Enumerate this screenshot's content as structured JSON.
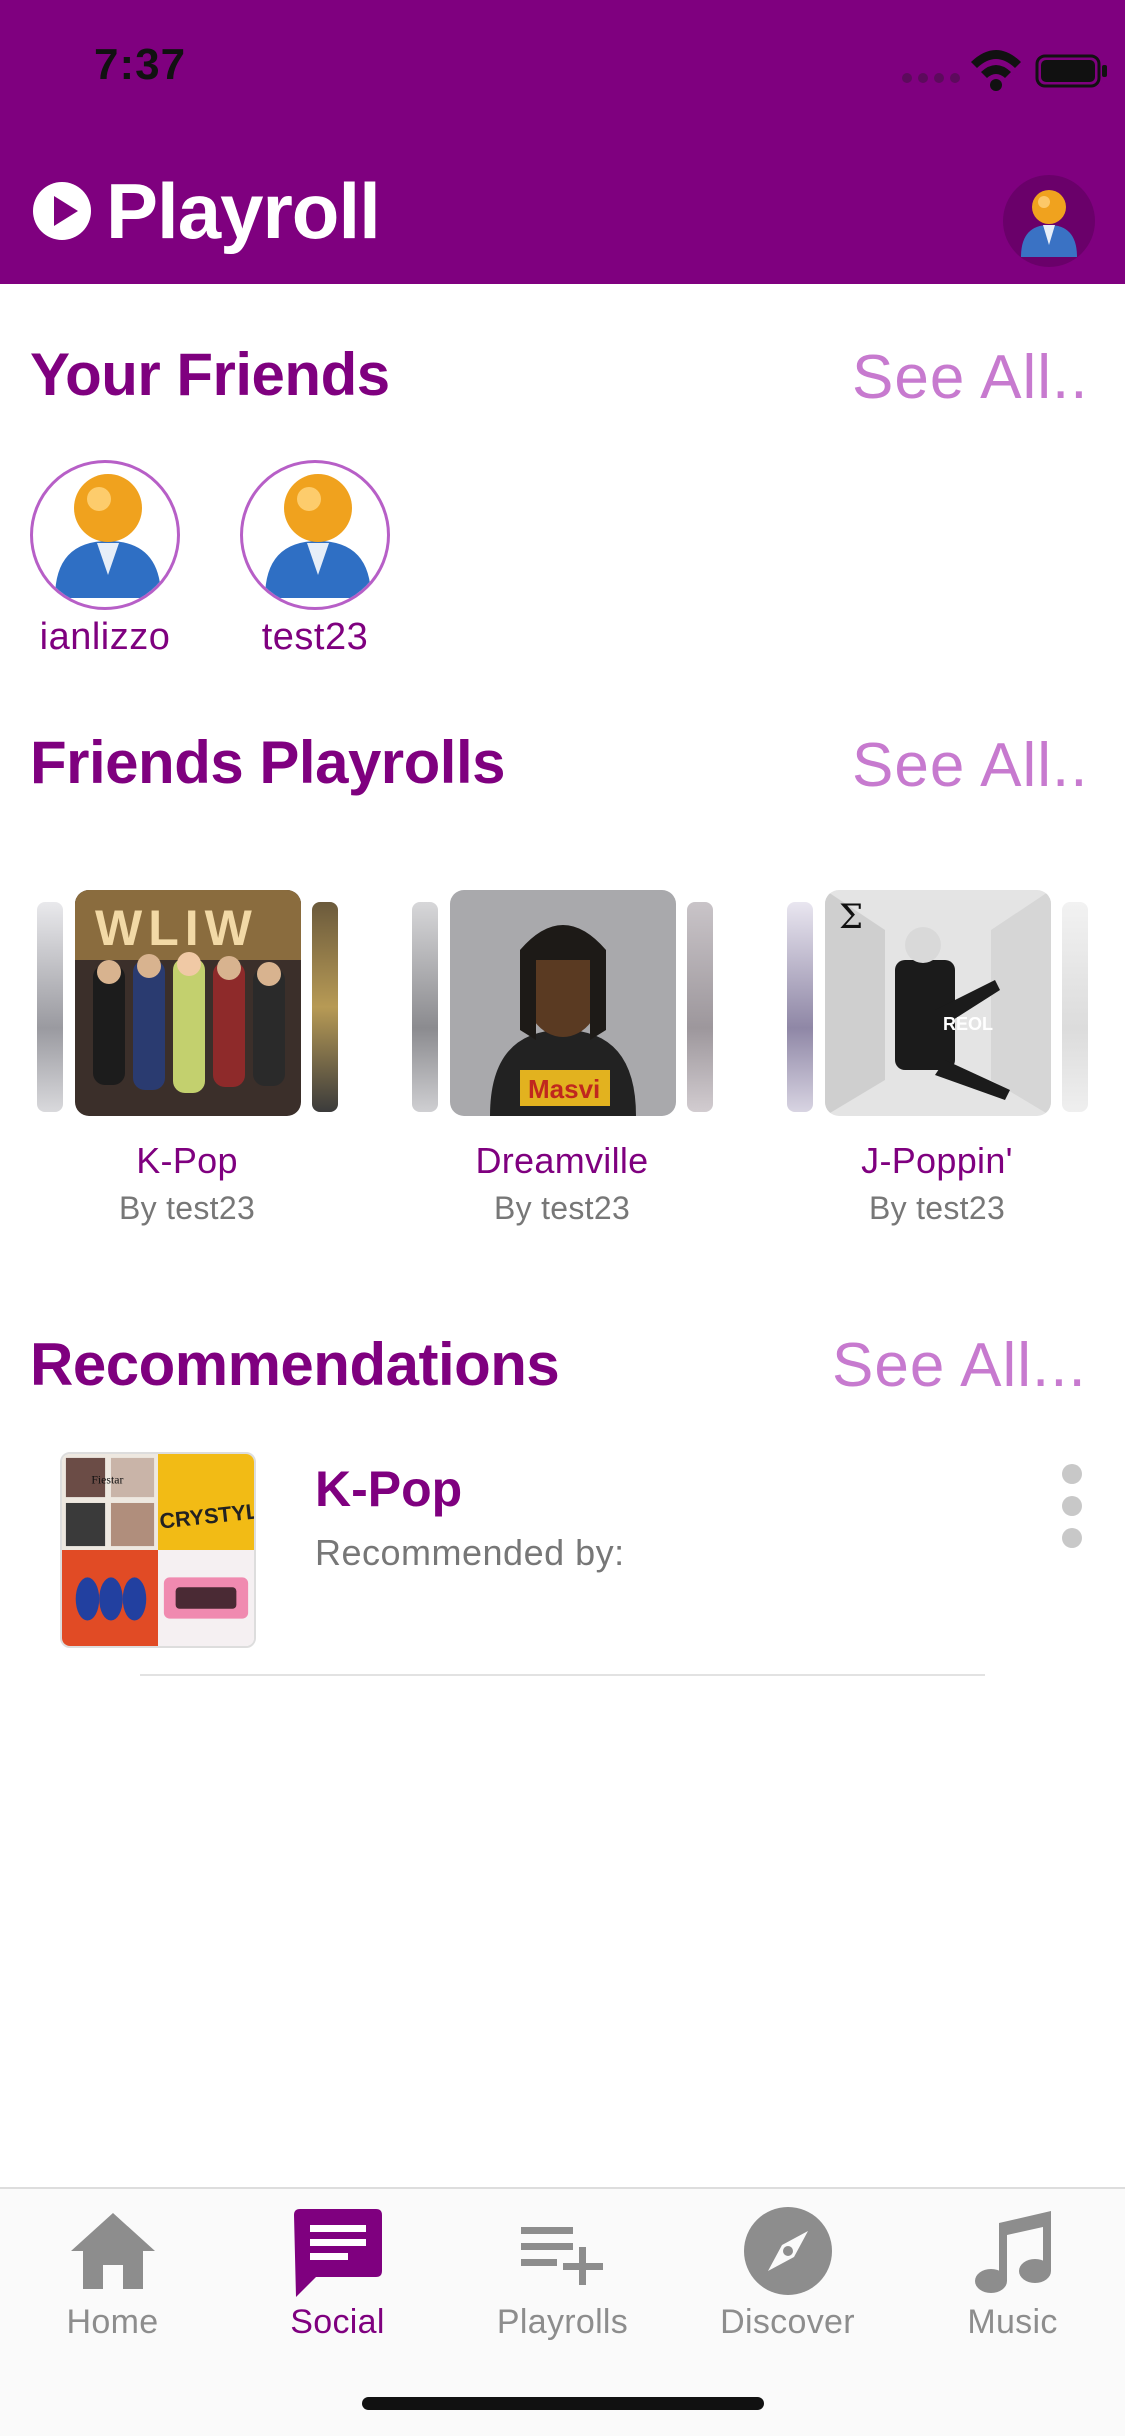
{
  "status_bar": {
    "time": "7:37"
  },
  "header": {
    "title": "Playroll",
    "icons": [
      "play-circle-icon",
      "profile-avatar-icon"
    ]
  },
  "friends": {
    "title": "Your Friends",
    "see_all": "See All..",
    "items": [
      {
        "name": "ianlizzo"
      },
      {
        "name": "test23"
      }
    ]
  },
  "friends_playrolls": {
    "title": "Friends Playrolls",
    "see_all": "See All..",
    "items": [
      {
        "name": "K-Pop",
        "owner": "By test23"
      },
      {
        "name": "Dreamville",
        "owner": "By test23"
      },
      {
        "name": "J-Poppin'",
        "owner": "By test23"
      }
    ]
  },
  "recommendations": {
    "title": "Recommendations",
    "see_all": "See All...",
    "items": [
      {
        "title": "K-Pop",
        "subtitle": "Recommended by:"
      }
    ]
  },
  "tabs": [
    {
      "label": "Home",
      "icon": "home-icon",
      "active": false
    },
    {
      "label": "Social",
      "icon": "chat-icon",
      "active": true
    },
    {
      "label": "Playrolls",
      "icon": "playlist-add-icon",
      "active": false
    },
    {
      "label": "Discover",
      "icon": "compass-icon",
      "active": false
    },
    {
      "label": "Music",
      "icon": "music-note-icon",
      "active": false
    }
  ],
  "colors": {
    "brand": "#7F007F",
    "see_all": "#C77ACF",
    "tab_inactive": "#8D8D8D"
  }
}
